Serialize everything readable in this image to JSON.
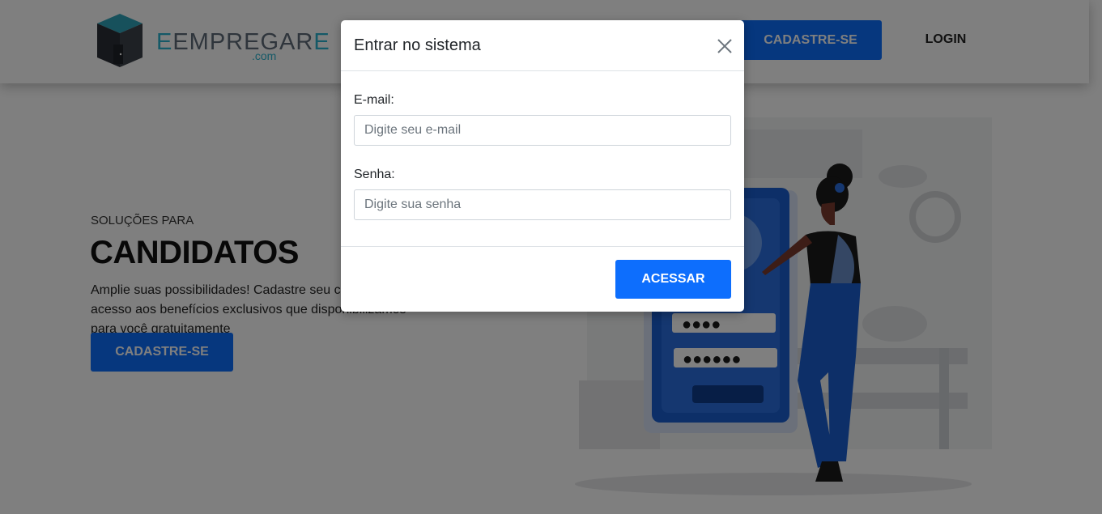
{
  "header": {
    "logo_text_main": "EMPREGAR",
    "logo_text_first": "E",
    "logo_text_last": "E",
    "logo_text_domain": ".com",
    "signup_label": "CADASTRE-SE",
    "login_label": "LOGIN"
  },
  "hero": {
    "kicker": "SOLUÇÕES PARA",
    "title": "CANDIDATOS",
    "description": "Amplie suas possibilidades! Cadastre seu currículo e tenha acesso aos benefícios exclusivos que disponibilizamos para você gratuitamente",
    "cta_label": "CADASTRE-SE"
  },
  "login_modal": {
    "title": "Entrar no sistema",
    "email_label": "E-mail:",
    "email_placeholder": "Digite seu e-mail",
    "email_value": "",
    "password_label": "Senha:",
    "password_placeholder": "Digite sua senha",
    "password_value": "",
    "submit_label": "ACESSAR",
    "close_icon": "close-icon"
  },
  "colors": {
    "primary": "#0d6efd",
    "logo_accent": "#2bb3cf",
    "logo_gray": "#5e6b78",
    "backdrop": "rgba(0,0,0,0.5)"
  }
}
